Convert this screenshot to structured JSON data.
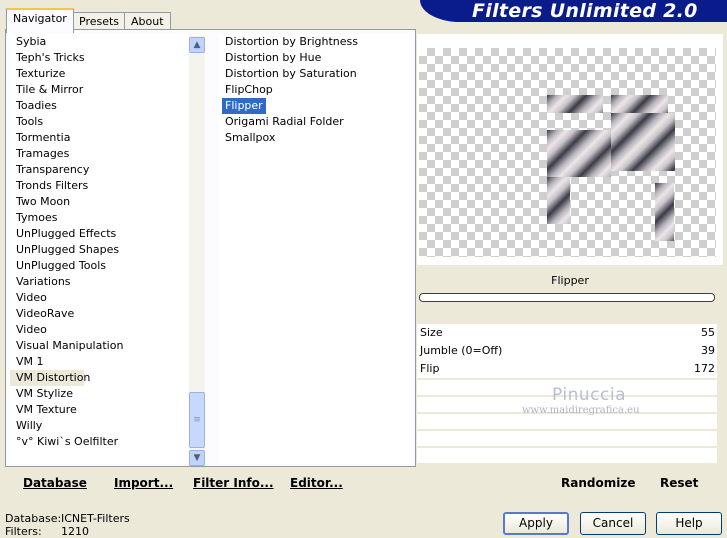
{
  "app": {
    "title": "Filters Unlimited 2.0"
  },
  "tabs": [
    {
      "label": "Navigator",
      "active": true
    },
    {
      "label": "Presets",
      "active": false
    },
    {
      "label": "About",
      "active": false
    }
  ],
  "categories": [
    "Sybia",
    "Teph's Tricks",
    "Texturize",
    "Tile & Mirror",
    "Toadies",
    "Tools",
    "Tormentia",
    "Tramages",
    "Transparency",
    "Tronds Filters",
    "Two Moon",
    "Tymoes",
    "UnPlugged Effects",
    "UnPlugged Shapes",
    "UnPlugged Tools",
    "Variations",
    "Video",
    "VideoRave",
    "Video",
    "Visual Manipulation",
    "VM 1",
    "VM Distortion",
    "VM Stylize",
    "VM Texture",
    "Willy",
    "°v° Kiwi`s Oelfilter"
  ],
  "selected_category": "VM Distortion",
  "filters": [
    "Distortion by Brightness",
    "Distortion by Hue",
    "Distortion by Saturation",
    "FlipChop",
    "Flipper",
    "Origami Radial Folder",
    "Smallpox"
  ],
  "selected_filter": "Flipper",
  "preview": {
    "filter_name": "Flipper"
  },
  "params": [
    {
      "label": "Size",
      "value": "55"
    },
    {
      "label": "Jumble (0=Off)",
      "value": "39"
    },
    {
      "label": "Flip",
      "value": "172"
    }
  ],
  "watermark": {
    "name": "Pinuccia",
    "url": "www.maidiregrafica.eu"
  },
  "left_buttons": {
    "database": "Database",
    "import": "Import...",
    "filter_info": "Filter Info...",
    "editor": "Editor..."
  },
  "right_buttons": {
    "randomize": "Randomize",
    "reset": "Reset"
  },
  "info": {
    "database_label": "Database:",
    "database_value": "ICNET-Filters",
    "filters_label": "Filters:",
    "filters_value": "1210"
  },
  "dialog_buttons": {
    "apply": "Apply",
    "cancel": "Cancel",
    "help": "Help"
  },
  "colors": {
    "banner": "#0a1c8c",
    "selection": "#316ac5",
    "background": "#ece9d8"
  }
}
